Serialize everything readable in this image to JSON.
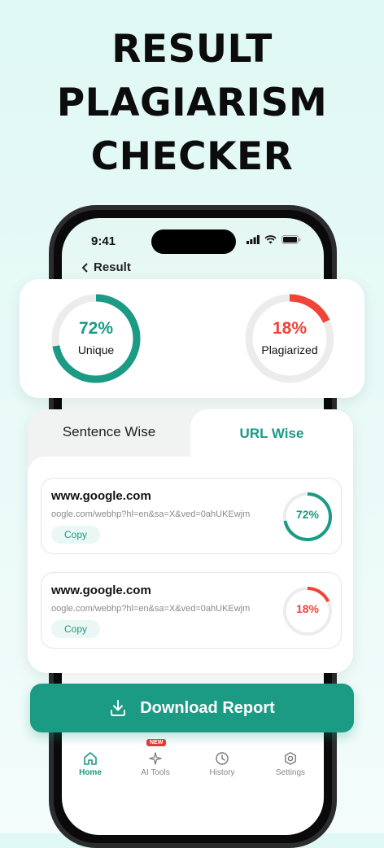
{
  "headline": [
    "RESULT",
    "PLAGIARISM",
    "CHECKER"
  ],
  "status_bar": {
    "time": "9:41"
  },
  "header": {
    "back_label": "Result"
  },
  "summary": {
    "unique": {
      "percent_text": "72%",
      "label": "Unique",
      "fraction": 0.72,
      "color": "#1b9a84"
    },
    "plagiarized": {
      "percent_text": "18%",
      "label": "Plagiarized",
      "fraction": 0.18,
      "color": "#f04438"
    }
  },
  "tabs": {
    "sentence_label": "Sentence Wise",
    "url_label": "URL Wise",
    "active": "URL Wise"
  },
  "url_results": [
    {
      "title": "www.google.com",
      "link": "oogle.com/webhp?hl=en&sa=X&ved=0ahUKEwjm",
      "copy_label": "Copy",
      "percent_text": "72%",
      "fraction": 0.72,
      "color": "#1b9a84"
    },
    {
      "title": "www.google.com",
      "link": "oogle.com/webhp?hl=en&sa=X&ved=0ahUKEwjm",
      "copy_label": "Copy",
      "percent_text": "18%",
      "fraction": 0.18,
      "color": "#f04438"
    }
  ],
  "download_label": "Download Report",
  "nav": {
    "home": "Home",
    "ai_tools": "AI Tools",
    "ai_badge": "NEW",
    "history": "History",
    "settings": "Settings"
  },
  "colors": {
    "accent": "#1b9a84",
    "danger": "#f04438"
  }
}
